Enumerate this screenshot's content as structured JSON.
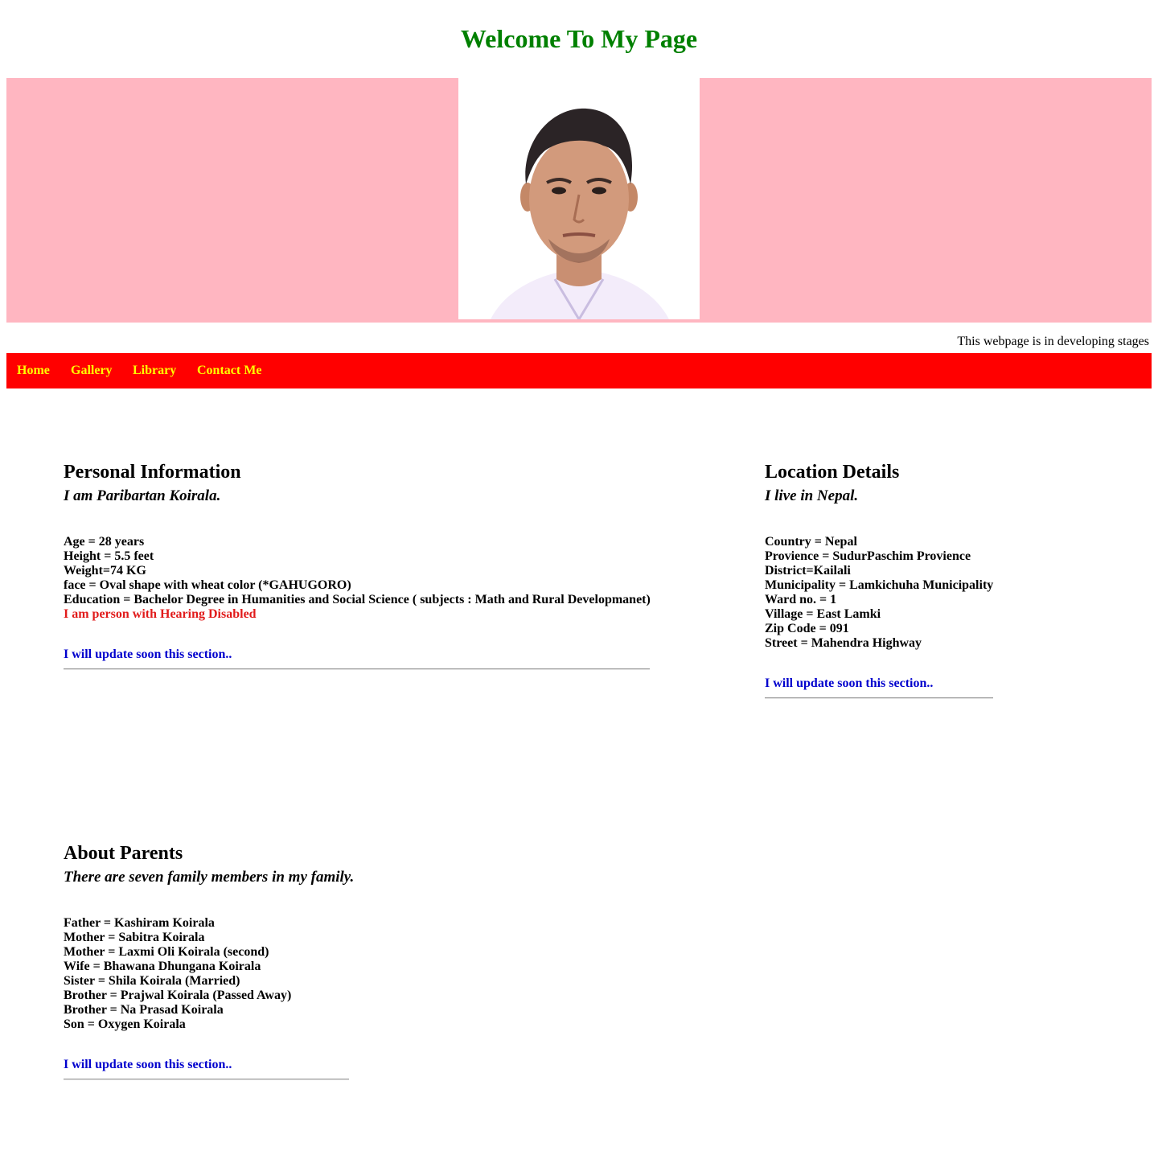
{
  "header": {
    "title": "Welcome To My Page"
  },
  "banner": {
    "background_color": "#ffb6c1",
    "photo_description": "portrait-photo"
  },
  "notice": "This webpage is in developing stages",
  "nav": {
    "background_color": "#ff0000",
    "link_color": "#ffff00",
    "items": [
      {
        "label": "Home"
      },
      {
        "label": "Gallery"
      },
      {
        "label": "Library"
      },
      {
        "label": "Contact Me"
      }
    ]
  },
  "personal": {
    "heading": "Personal Information",
    "intro": "I am Paribartan Koirala.",
    "lines": [
      "Age = 28 years",
      "Height = 5.5 feet",
      "Weight=74 KG",
      "face = Oval shape with wheat color (*GAHUGORO)",
      "Education = Bachelor Degree in Humanities and Social Science ( subjects : Math and Rural Developmanet)"
    ],
    "highlight": "I am person with Hearing Disabled",
    "update": "I will update soon this section.."
  },
  "location": {
    "heading": "Location Details",
    "intro": "I live in Nepal.",
    "lines": [
      "Country = Nepal",
      "Provience = SudurPaschim Provience",
      "District=Kailali",
      "Municipality = Lamkichuha Municipality",
      "Ward no. = 1",
      "Village = East Lamki",
      "Zip Code = 091",
      "Street = Mahendra Highway"
    ],
    "update": "I will update soon this section.."
  },
  "parents": {
    "heading": "About Parents",
    "intro": "There are seven family members in my family.",
    "lines": [
      "Father = Kashiram Koirala",
      "Mother = Sabitra Koirala",
      "Mother = Laxmi Oli Koirala (second)",
      "Wife = Bhawana Dhungana Koirala",
      "Sister = Shila Koirala (Married)",
      "Brother = Prajwal Koirala (Passed Away)",
      "Brother = Na Prasad Koirala",
      "Son = Oxygen Koirala"
    ],
    "update": "I will update soon this section.."
  }
}
